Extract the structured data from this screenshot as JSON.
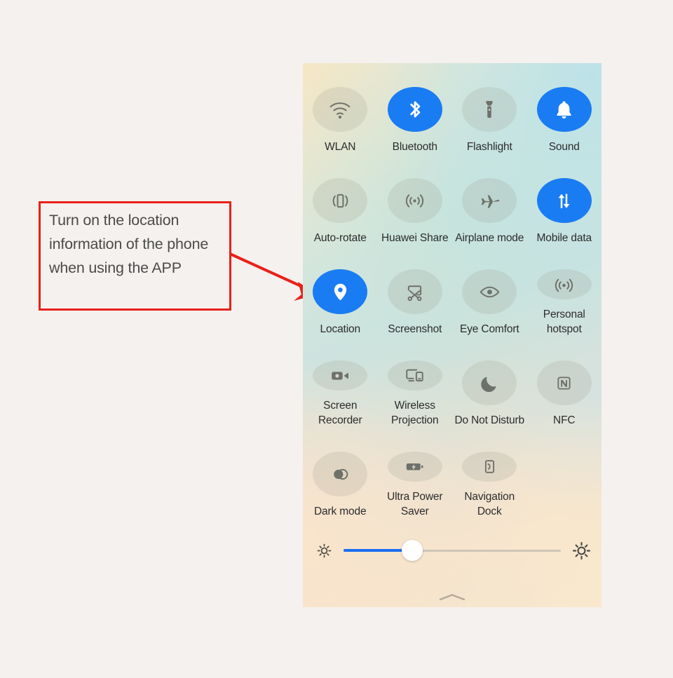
{
  "page": {
    "background_color": "#f5f1ee"
  },
  "annotation": {
    "text": "Turn on the location information of the phone when using the APP",
    "border_color": "#e8211a",
    "arrow_color": "#e8211a",
    "arrow_icon": "arrow-pointing-right-down",
    "points_to": "Location"
  },
  "control_panel": {
    "accent_color": "#1a7cf2",
    "inactive_icon_color": "#6e7169",
    "label_color": "#2c2c2c",
    "tiles": [
      {
        "label": "WLAN",
        "icon": "wifi-icon",
        "state": "off"
      },
      {
        "label": "Bluetooth",
        "icon": "bluetooth-icon",
        "state": "on"
      },
      {
        "label": "Flashlight",
        "icon": "flashlight-icon",
        "state": "off"
      },
      {
        "label": "Sound",
        "icon": "bell-icon",
        "state": "on"
      },
      {
        "label": "Auto-rotate",
        "icon": "auto-rotate-icon",
        "state": "off"
      },
      {
        "label": "Huawei Share",
        "icon": "huawei-share-icon",
        "state": "off"
      },
      {
        "label": "Airplane mode",
        "icon": "airplane-icon",
        "state": "off"
      },
      {
        "label": "Mobile data",
        "icon": "mobile-data-arrows-icon",
        "state": "on"
      },
      {
        "label": "Location",
        "icon": "location-pin-icon",
        "state": "on"
      },
      {
        "label": "Screenshot",
        "icon": "screenshot-scissors-icon",
        "state": "off"
      },
      {
        "label": "Eye Comfort",
        "icon": "eye-icon",
        "state": "off"
      },
      {
        "label": "Personal hotspot",
        "icon": "hotspot-icon",
        "state": "off"
      },
      {
        "label": "Screen Recorder",
        "icon": "video-camera-icon",
        "state": "off"
      },
      {
        "label": "Wireless Projection",
        "icon": "cast-screen-icon",
        "state": "off"
      },
      {
        "label": "Do Not Disturb",
        "icon": "moon-icon",
        "state": "off"
      },
      {
        "label": "NFC",
        "icon": "nfc-icon",
        "state": "off"
      },
      {
        "label": "Dark mode",
        "icon": "dark-mode-circles-icon",
        "state": "off"
      },
      {
        "label": "Ultra Power Saver",
        "icon": "battery-bolt-icon",
        "state": "off"
      },
      {
        "label": "Navigation Dock",
        "icon": "navigation-dock-icon",
        "state": "off"
      }
    ],
    "brightness": {
      "low_icon": "brightness-low-icon",
      "high_icon": "brightness-high-icon",
      "value_percent": 32,
      "fill_color": "#1a6ff0",
      "track_color": "#cfc6b8"
    },
    "handle_icon": "collapse-chevron-up-icon"
  }
}
